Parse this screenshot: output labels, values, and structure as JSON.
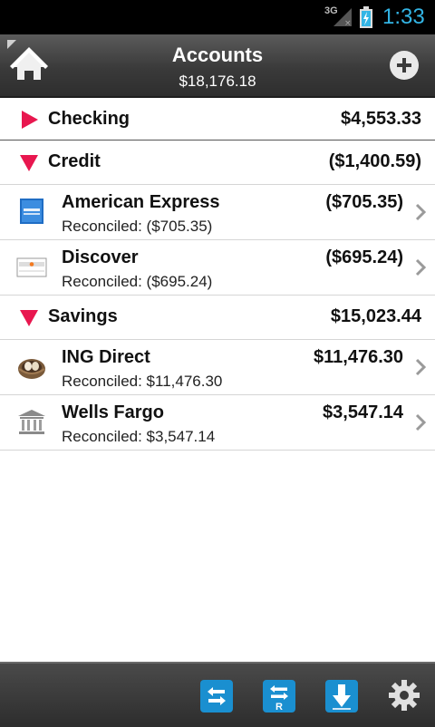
{
  "status_bar": {
    "network": "3G",
    "time": "1:33",
    "icons": [
      "signal-icon",
      "battery-icon"
    ]
  },
  "header": {
    "title": "Accounts",
    "total": "$18,176.18",
    "icons": [
      "home-icon",
      "add-icon"
    ]
  },
  "groups": [
    {
      "name": "Checking",
      "total": "$4,553.33",
      "expanded": false,
      "accounts": []
    },
    {
      "name": "Credit",
      "total": "($1,400.59)",
      "expanded": true,
      "accounts": [
        {
          "name": "American Express",
          "balance": "($705.35)",
          "reconciled": "Reconciled: ($705.35)",
          "icon": "amex-logo-icon"
        },
        {
          "name": "Discover",
          "balance": "($695.24)",
          "reconciled": "Reconciled: ($695.24)",
          "icon": "discover-logo-icon"
        }
      ]
    },
    {
      "name": "Savings",
      "total": "$15,023.44",
      "expanded": true,
      "accounts": [
        {
          "name": "ING Direct",
          "balance": "$11,476.30",
          "reconciled": "Reconciled: $11,476.30",
          "icon": "nest-icon"
        },
        {
          "name": "Wells Fargo",
          "balance": "$3,547.14",
          "reconciled": "Reconciled: $3,547.14",
          "icon": "bank-icon"
        }
      ]
    }
  ],
  "toolbar": {
    "buttons": [
      "transfer-icon",
      "reconcile-transfer-icon",
      "download-icon",
      "gear-icon"
    ],
    "reconcile_letter": "R"
  },
  "colors": {
    "accent_triangle": "#e8174f",
    "toolbar_button": "#1a8fd0",
    "clock": "#33b5e5"
  }
}
